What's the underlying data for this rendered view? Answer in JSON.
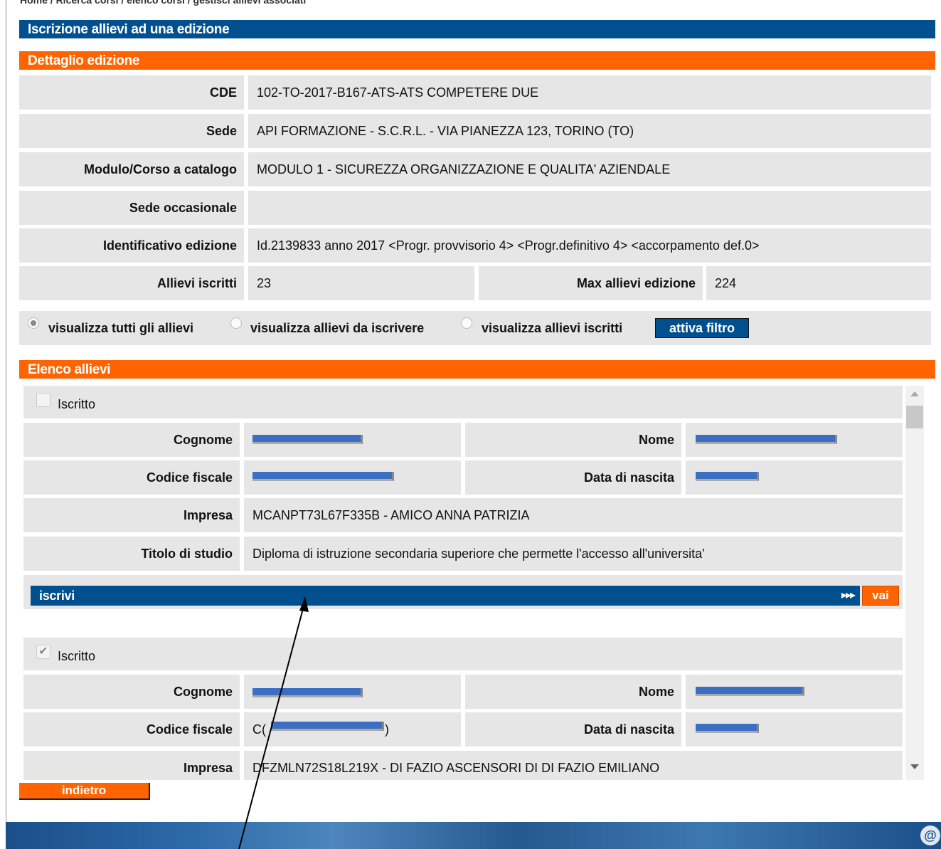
{
  "breadcrumb": "Home / Ricerca corsi / elenco corsi / gestisci allievi associati",
  "header_title": "Iscrizione allievi ad una edizione",
  "detail": {
    "title": "Dettaglio edizione",
    "cde_label": "CDE",
    "cde_value": "102-TO-2017-B167-ATS-ATS COMPETERE DUE",
    "sede_label": "Sede",
    "sede_value": "API FORMAZIONE - S.C.R.L. - VIA PIANEZZA 123, TORINO (TO)",
    "modulo_label": "Modulo/Corso a catalogo",
    "modulo_value": "MODULO 1 - SICUREZZA ORGANIZZAZIONE E QUALITA' AZIENDALE",
    "sede_occ_label": "Sede occasionale",
    "sede_occ_value": "",
    "ident_label": "Identificativo edizione",
    "ident_value": "Id.2139833 anno 2017 <Progr. provvisorio 4> <Progr.definitivo 4> <accorpamento def.0>",
    "iscritti_label": "Allievi iscritti",
    "iscritti_value": "23",
    "max_label": "Max allievi edizione",
    "max_value": "224"
  },
  "filter": {
    "opt_all": "visualizza tutti gli allievi",
    "opt_da_iscrivere": "visualizza allievi da iscrivere",
    "opt_iscritti": "visualizza allievi iscritti",
    "selected": "visualizza tutti gli allievi",
    "button": "attiva filtro"
  },
  "list": {
    "title": "Elenco allievi",
    "students": [
      {
        "iscritto_label": "Iscritto",
        "iscritto_checked": false,
        "cognome_label": "Cognome",
        "nome_label": "Nome",
        "cf_label": "Codice fiscale",
        "nascita_label": "Data di nascita",
        "impresa_label": "Impresa",
        "impresa_value": "MCANPT73L67F335B - AMICO ANNA PATRIZIA",
        "titolo_label": "Titolo di studio",
        "titolo_value": "Diploma di istruzione secondaria superiore che permette l'accesso all'universita'",
        "action_label": "iscrivi",
        "action_arrows": "▸▸▸",
        "action_button": "vai"
      },
      {
        "iscritto_label": "Iscritto",
        "iscritto_checked": true,
        "cognome_label": "Cognome",
        "nome_label": "Nome",
        "cf_label": "Codice fiscale",
        "cf_prefix": "C(",
        "cf_suffix": ")",
        "nascita_label": "Data di nascita",
        "impresa_label": "Impresa",
        "impresa_value": "DFZMLN72S18L219X - DI FAZIO ASCENSORI DI DI FAZIO EMILIANO"
      }
    ]
  },
  "back_button": "indietro",
  "footer_at": "@",
  "colors": {
    "blue": "#00508f",
    "orange": "#ff6400",
    "cell": "#e6e6e6",
    "redaction": "#3b6fc4"
  }
}
